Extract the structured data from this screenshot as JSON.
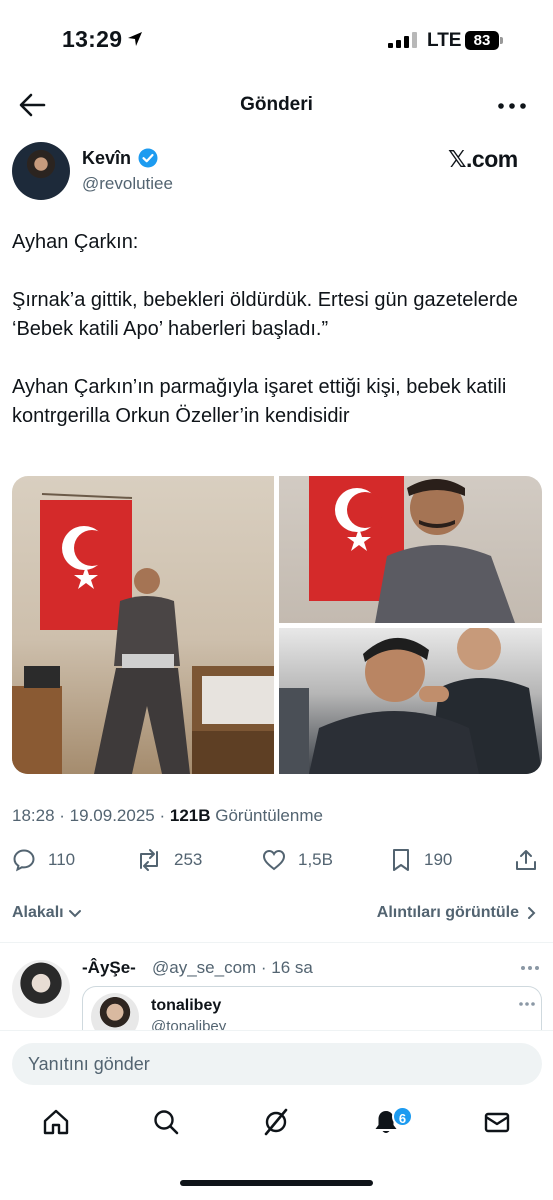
{
  "status_bar": {
    "time": "13:29",
    "network": "LTE",
    "battery": "83",
    "icons": [
      "location-arrow-icon",
      "signal-icon",
      "battery-icon"
    ]
  },
  "header": {
    "title": "Gönderi",
    "back_icon": "arrow-left-icon",
    "more_icon": "more-dots-icon"
  },
  "author": {
    "name": "Kevîn",
    "handle": "@revolutiee",
    "verified": true,
    "source": "𝕏.com"
  },
  "tweet": {
    "paragraphs": [
      "Ayhan Çarkın:",
      "Şırnak’a gittik, bebekleri öldürdük. Ertesi gün gazetelerde ‘Bebek katili Apo’ haberleri başladı.”",
      "Ayhan Çarkın’ın parmağıyla işaret ettiği kişi, bebek katili kontrgerilla Orkun Özeller’in kendisidir"
    ],
    "time": "18:28",
    "date": "19.09.2025",
    "views_count": "121B",
    "views_label": "Görüntülenme"
  },
  "actions": {
    "replies": "110",
    "reposts": "253",
    "likes": "1,5B",
    "bookmarks": "190"
  },
  "related": {
    "left_label": "Alakalı",
    "right_label": "Alıntıları görüntüle"
  },
  "reply": {
    "name": "-ÂyŞe-",
    "handle": "@ay_se_com · 16 sa",
    "quote_name": "tonalibey",
    "quote_handle": "@tonalibey"
  },
  "compose": {
    "placeholder": "Yanıtını gönder"
  },
  "tabbar": {
    "notifications_badge": "6",
    "tabs": [
      "home-icon",
      "search-icon",
      "grok-icon",
      "bell-icon",
      "mail-icon"
    ]
  },
  "colors": {
    "accent": "#1d9bf0",
    "text": "#0f1419",
    "secondary": "#536471"
  }
}
